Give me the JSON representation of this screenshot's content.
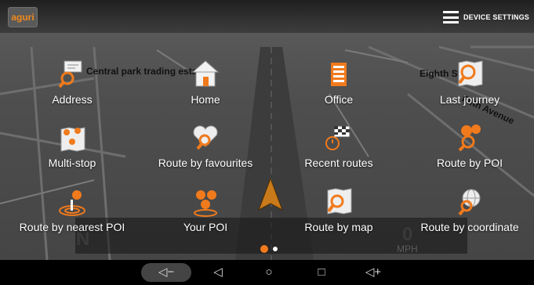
{
  "app": {
    "logo_text": "aguri"
  },
  "header": {
    "settings_label": "DEVICE SETTINGS"
  },
  "map": {
    "streets": [
      "Central park trading estate",
      "Eighth Street",
      "Fifth Avenue"
    ],
    "compass": "N",
    "speed": "0",
    "speed_unit": "MPH"
  },
  "menu": {
    "items": [
      {
        "label": "Address",
        "icon": "address-search-icon"
      },
      {
        "label": "Home",
        "icon": "home-icon"
      },
      {
        "label": "Office",
        "icon": "office-building-icon"
      },
      {
        "label": "Last journey",
        "icon": "map-search-icon"
      },
      {
        "label": "Multi-stop",
        "icon": "multi-stop-map-icon"
      },
      {
        "label": "Route by favourites",
        "icon": "heart-search-icon"
      },
      {
        "label": "Recent routes",
        "icon": "checkered-flag-clock-icon"
      },
      {
        "label": "Route by POI",
        "icon": "poi-search-icon"
      },
      {
        "label": "Route by nearest POI",
        "icon": "nearest-poi-icon"
      },
      {
        "label": "Your POI",
        "icon": "your-poi-icon"
      },
      {
        "label": "Route by map",
        "icon": "map-search-icon"
      },
      {
        "label": "Route by coordinate",
        "icon": "globe-search-icon"
      }
    ]
  },
  "pager": {
    "pages": 2,
    "current": 1
  },
  "navbar": {
    "volume_down": "◁−",
    "back": "◁",
    "home": "○",
    "recents": "□",
    "volume_up": "◁+"
  },
  "colors": {
    "accent": "#f07a1c",
    "map_bg": "#555555"
  }
}
